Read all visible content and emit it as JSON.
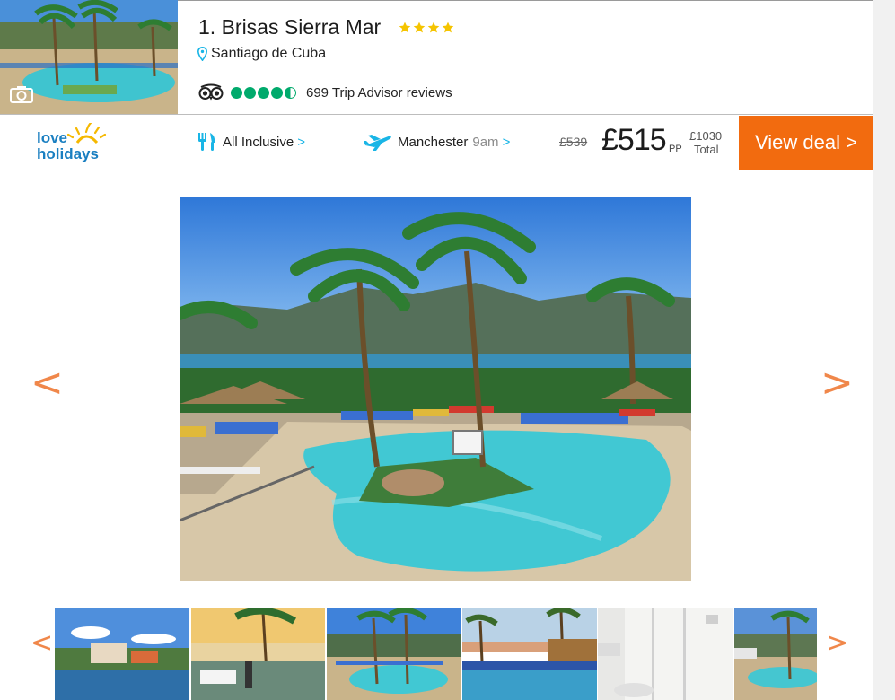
{
  "hotel": {
    "rank_title": "1. Brisas Sierra Mar",
    "star_rating": 4,
    "location": "Santiago de Cuba",
    "tripadvisor": {
      "rating_bubbles": 4.5,
      "reviews_text": "699 Trip Advisor reviews"
    }
  },
  "deal": {
    "provider_logo": {
      "line1": "love",
      "line2": "holidays"
    },
    "board": "All Inclusive",
    "board_chevron": ">",
    "departure_airport": "Manchester",
    "departure_time": "9am",
    "flight_chevron": ">",
    "old_price": "£539",
    "price": "£515",
    "price_suffix": "PP",
    "total_price": "£1030",
    "total_label": "Total",
    "view_deal_label": "View deal >"
  },
  "gallery": {
    "prev_arrow": "<",
    "next_arrow": ">",
    "thumb_prev_arrow": "<",
    "thumb_next_arrow": ">",
    "thumbnail_count": 6,
    "active_thumbnail": 3
  },
  "icons": {
    "camera": "camera-icon",
    "location": "map-pin-icon",
    "tripadvisor": "tripadvisor-owl-icon",
    "meal": "cutlery-icon",
    "flight": "plane-icon"
  },
  "colors": {
    "accent_orange": "#f26b0f",
    "arrow_orange": "#f0874a",
    "star_gold": "#f5c400",
    "tripadvisor_green": "#00aa6c",
    "link_blue": "#19b5e6"
  }
}
